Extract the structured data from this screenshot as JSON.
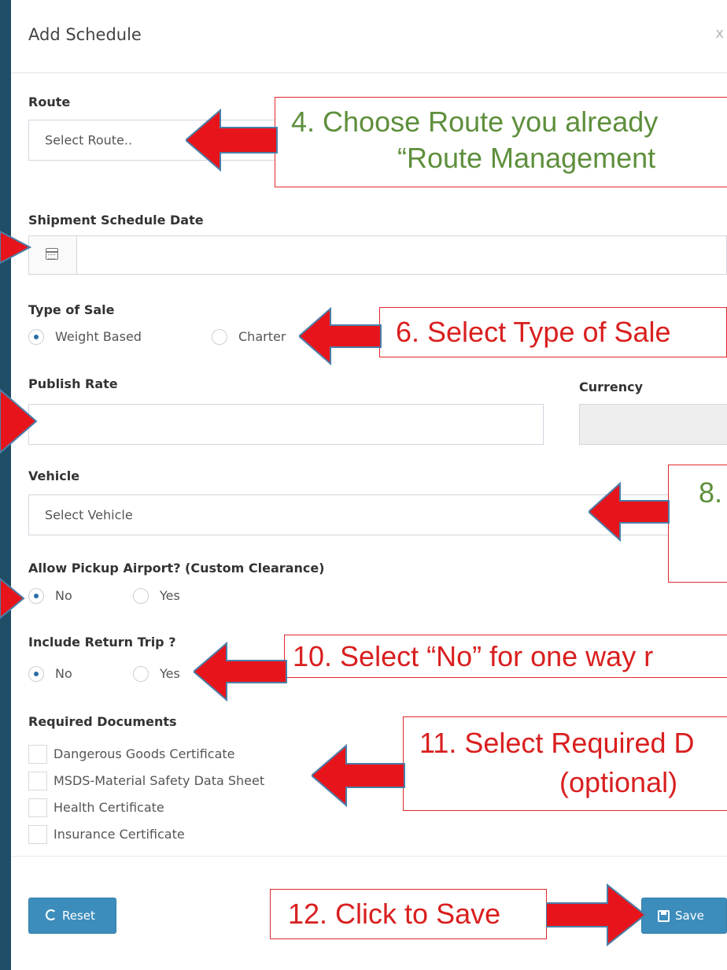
{
  "modal": {
    "title": "Add Schedule",
    "close": "x"
  },
  "route": {
    "label": "Route",
    "placeholder": "Select Route.."
  },
  "schedule_date": {
    "label": "Shipment Schedule Date",
    "value": ""
  },
  "type_of_sale": {
    "label": "Type of Sale",
    "options": [
      "Weight Based",
      "Charter"
    ],
    "selected": "Weight Based"
  },
  "publish_rate": {
    "label": "Publish Rate",
    "value": ""
  },
  "currency": {
    "label": "Currency",
    "value": ""
  },
  "vehicle": {
    "label": "Vehicle",
    "placeholder": "Select Vehicle"
  },
  "pickup_airport": {
    "label": "Allow Pickup Airport? (Custom Clearance)",
    "options": [
      "No",
      "Yes"
    ],
    "selected": "No"
  },
  "return_trip": {
    "label": "Include Return Trip ?",
    "options": [
      "No",
      "Yes"
    ],
    "selected": "No"
  },
  "required_docs": {
    "label": "Required Documents",
    "items": [
      "Dangerous Goods Certificate",
      "MSDS-Material Safety Data Sheet",
      "Health Certificate",
      "Insurance Certificate"
    ]
  },
  "footer": {
    "reset_label": "Reset",
    "save_label": "Save"
  },
  "annotations": {
    "step4_line1": "4. Choose Route you already",
    "step4_line2": "“Route Management",
    "step6": "6. Select Type of Sale",
    "step8": "8.",
    "step10": "10. Select “No” for one way r",
    "step11_line1": "11. Select Required D",
    "step11_line2": "(optional)",
    "step12": "12. Click to Save"
  },
  "colors": {
    "annotation_border": "#e0282b",
    "arrow_fill": "#e8141b",
    "green_text": "#5e8f3c",
    "red_text": "#d91f1f",
    "button_blue": "#3c8dbc",
    "backdrop": "#1f4e66"
  }
}
